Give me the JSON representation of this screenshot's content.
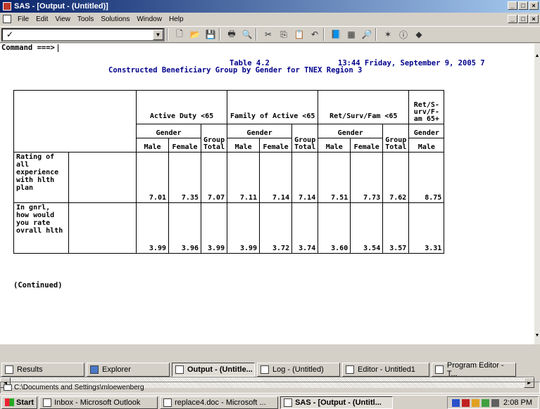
{
  "window": {
    "title": "SAS - [Output - (Untitled)]"
  },
  "menu": {
    "items": [
      "File",
      "Edit",
      "View",
      "Tools",
      "Solutions",
      "Window",
      "Help"
    ]
  },
  "toolbar": {
    "command_check": "✓",
    "dropdown": "▼"
  },
  "output": {
    "command_prompt": "Command ===>",
    "header_table": "Table 4.2",
    "header_datetime": "13:44 Friday, September 9, 2005   7",
    "header_title": "Constructed Beneficiary Group by Gender for TNEX Region 3",
    "groups": [
      "Active Duty <65",
      "Family of Active <65",
      "Ret/Surv/Fam <65",
      "Ret/S-urv/F-am 65+"
    ],
    "gender_label": "Gender",
    "cols": [
      "Male",
      "Female",
      "Group Total",
      "Male",
      "Female",
      "Group Total",
      "Male",
      "Female",
      "Group Total",
      "Male"
    ],
    "rows": [
      {
        "label": "Rating of all experience with hlth plan",
        "values": [
          "7.01",
          "7.35",
          "7.07",
          "7.11",
          "7.14",
          "7.14",
          "7.51",
          "7.73",
          "7.62",
          "8.75"
        ]
      },
      {
        "label": "In gnrl, how would you rate ovrall hlth",
        "values": [
          "3.99",
          "3.96",
          "3.99",
          "3.99",
          "3.72",
          "3.74",
          "3.60",
          "3.54",
          "3.57",
          "3.31"
        ]
      }
    ],
    "continued": "(Continued)"
  },
  "window_tabs": [
    "Results",
    "Explorer",
    "Output - (Untitle...",
    "Log - (Untitled)",
    "Editor - Untitled1",
    "Program Editor - T..."
  ],
  "status": {
    "path": "C:\\Documents and Settings\\mloewenberg"
  },
  "taskbar": {
    "start": "Start",
    "tasks": [
      "Inbox - Microsoft Outlook",
      "replace4.doc - Microsoft ...",
      "SAS - [Output - (Untitl..."
    ],
    "clock": "2:08 PM"
  }
}
